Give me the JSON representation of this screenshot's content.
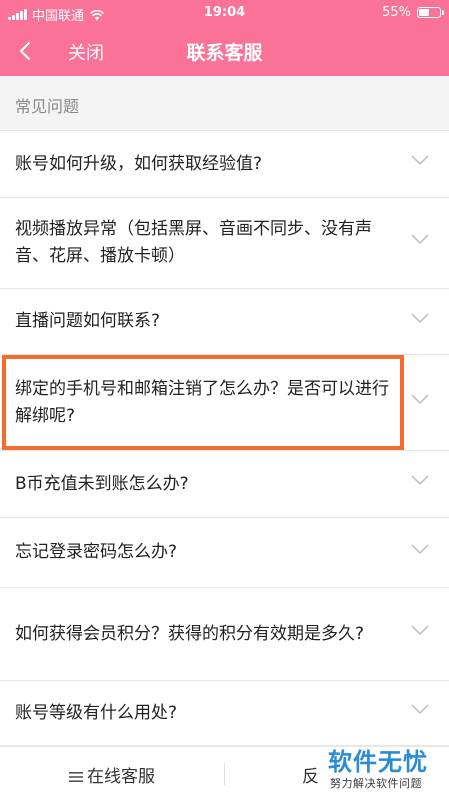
{
  "status_bar": {
    "carrier": "中国联通",
    "time": "19:04",
    "battery": "55%",
    "battery_level": 0.55
  },
  "nav": {
    "close_label": "关闭",
    "title": "联系客服"
  },
  "section": {
    "title": "常见问题"
  },
  "faq": [
    {
      "text": "账号如何升级，如何获取经验值?"
    },
    {
      "text": "视频播放异常（包括黑屏、音画不同步、没有声音、花屏、播放卡顿）"
    },
    {
      "text": "直播问题如何联系?"
    },
    {
      "text": "绑定的手机号和邮箱注销了怎么办？是否可以进行解绑呢?"
    },
    {
      "text": "B币充值未到账怎么办?"
    },
    {
      "text": "忘记登录密码怎么办?"
    },
    {
      "text": "如何获得会员积分？获得的积分有效期是多久?"
    },
    {
      "text": "账号等级有什么用处?"
    }
  ],
  "bottom": {
    "online_service": "在线客服",
    "feedback_partial": "反"
  },
  "watermark": {
    "title": "软件无忧",
    "subtitle": "努力解决软件问题"
  },
  "colors": {
    "brand_pink": "#fb7299",
    "highlight_orange": "#f66b2e",
    "watermark_blue": "#2a8bd8"
  }
}
